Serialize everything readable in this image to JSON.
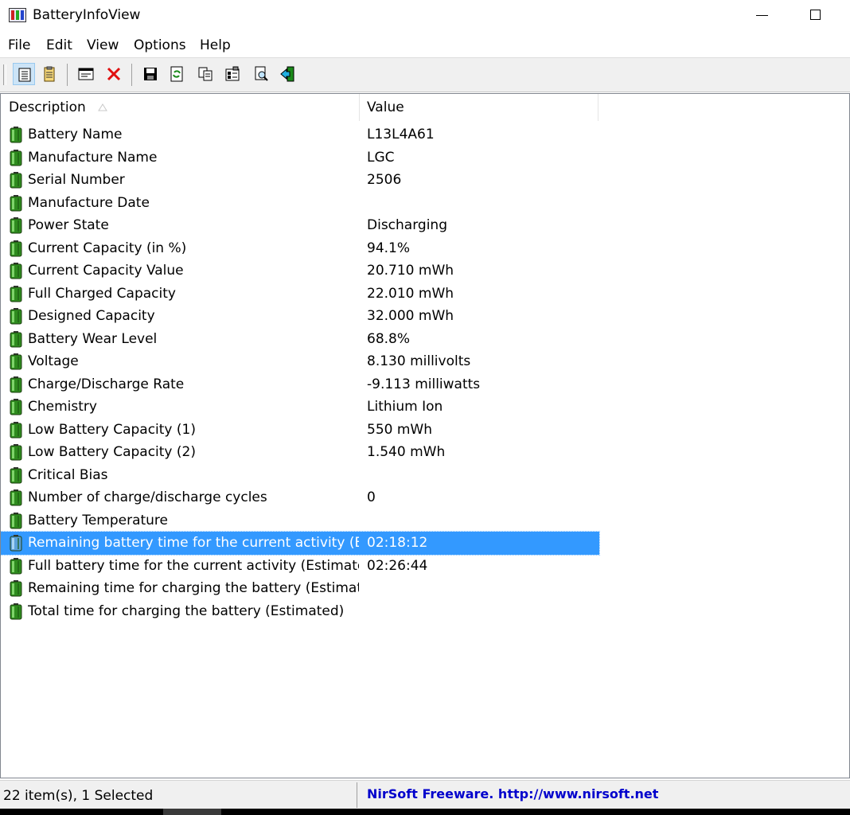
{
  "window": {
    "title": "BatteryInfoView"
  },
  "menu": [
    "File",
    "Edit",
    "View",
    "Options",
    "Help"
  ],
  "toolbar": {
    "buttons": [
      "view-table-icon",
      "view-report-icon",
      "properties-icon",
      "delete-icon",
      "save-icon",
      "refresh-icon",
      "copy-icon",
      "options-icon",
      "find-icon",
      "exit-icon"
    ]
  },
  "columns": {
    "description": "Description",
    "value": "Value"
  },
  "rows": [
    {
      "description": "Battery Name",
      "value": "L13L4A61"
    },
    {
      "description": "Manufacture Name",
      "value": "LGC"
    },
    {
      "description": "Serial Number",
      "value": " 2506"
    },
    {
      "description": "Manufacture Date",
      "value": ""
    },
    {
      "description": "Power State",
      "value": "Discharging"
    },
    {
      "description": "Current Capacity (in %)",
      "value": "94.1%"
    },
    {
      "description": "Current Capacity Value",
      "value": "20.710 mWh"
    },
    {
      "description": "Full Charged Capacity",
      "value": "22.010 mWh"
    },
    {
      "description": "Designed Capacity",
      "value": "32.000 mWh"
    },
    {
      "description": "Battery Wear Level",
      "value": "68.8%"
    },
    {
      "description": "Voltage",
      "value": "8.130 millivolts"
    },
    {
      "description": "Charge/Discharge Rate",
      "value": "-9.113 milliwatts"
    },
    {
      "description": "Chemistry",
      "value": "Lithium Ion"
    },
    {
      "description": "Low Battery Capacity (1)",
      "value": "550 mWh"
    },
    {
      "description": "Low Battery Capacity (2)",
      "value": "1.540 mWh"
    },
    {
      "description": "Critical Bias",
      "value": ""
    },
    {
      "description": "Number of charge/discharge cycles",
      "value": "0"
    },
    {
      "description": "Battery Temperature",
      "value": ""
    },
    {
      "description": "Remaining battery time for the current activity (Est...",
      "value": "02:18:12",
      "selected": true
    },
    {
      "description": "Full battery time for the current activity (Estimated)",
      "value": "02:26:44"
    },
    {
      "description": "Remaining time for charging the battery (Estimated)",
      "value": ""
    },
    {
      "description": "Total  time for charging the battery (Estimated)",
      "value": ""
    }
  ],
  "status": {
    "items": "22 item(s), 1 Selected",
    "credit": "NirSoft Freeware.  http://www.nirsoft.net"
  },
  "colors": {
    "selection": "#3399ff",
    "battery": "#2e8b1e",
    "link": "#0000cc"
  }
}
